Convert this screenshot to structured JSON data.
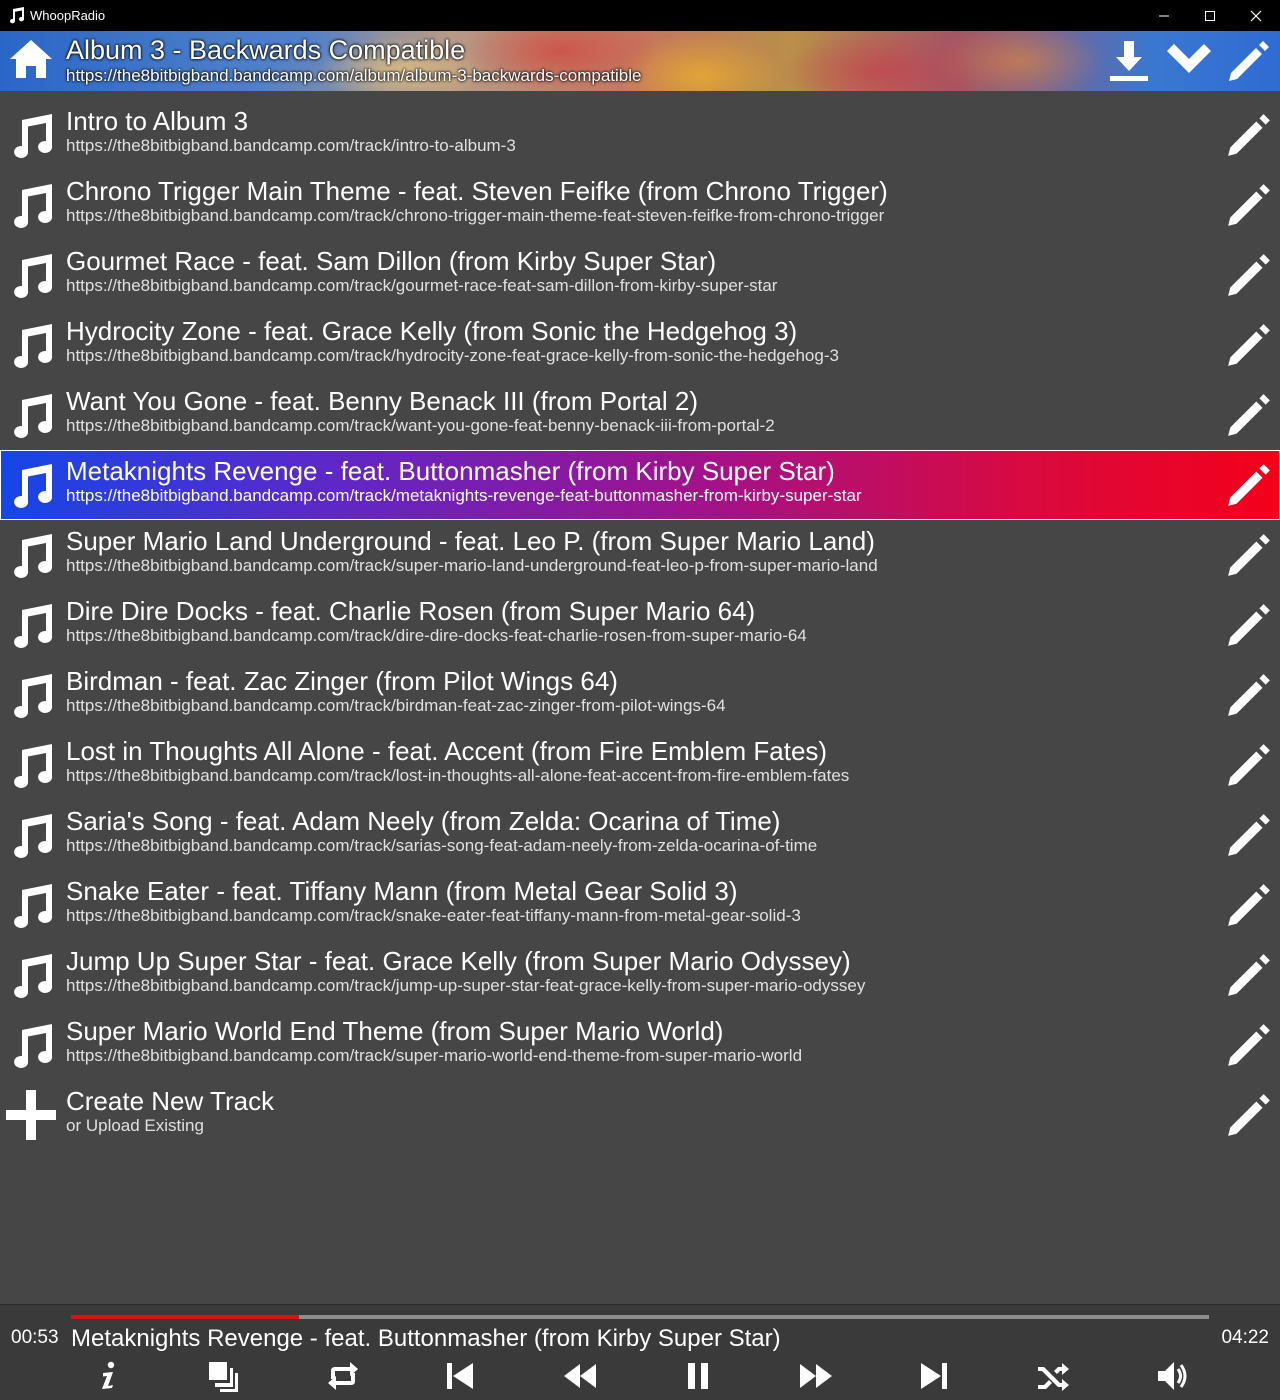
{
  "window": {
    "title": "WhoopRadio",
    "buttons": [
      "minimize",
      "maximize",
      "close"
    ]
  },
  "album": {
    "title": "Album 3 - Backwards Compatible",
    "url": "https://the8bitbigband.bandcamp.com/album/album-3-backwards-compatible",
    "actions": [
      "download-icon",
      "chevron-down-icon",
      "edit-icon"
    ]
  },
  "tracks": [
    {
      "title": "Intro to Album 3",
      "url": "https://the8bitbigband.bandcamp.com/track/intro-to-album-3"
    },
    {
      "title": "Chrono Trigger Main Theme - feat. Steven Feifke (from Chrono Trigger)",
      "url": "https://the8bitbigband.bandcamp.com/track/chrono-trigger-main-theme-feat-steven-feifke-from-chrono-trigger"
    },
    {
      "title": "Gourmet Race - feat. Sam Dillon (from Kirby Super Star)",
      "url": "https://the8bitbigband.bandcamp.com/track/gourmet-race-feat-sam-dillon-from-kirby-super-star"
    },
    {
      "title": "Hydrocity Zone - feat. Grace Kelly (from Sonic the Hedgehog 3)",
      "url": "https://the8bitbigband.bandcamp.com/track/hydrocity-zone-feat-grace-kelly-from-sonic-the-hedgehog-3"
    },
    {
      "title": "Want You Gone - feat. Benny Benack III (from Portal 2)",
      "url": "https://the8bitbigband.bandcamp.com/track/want-you-gone-feat-benny-benack-iii-from-portal-2"
    },
    {
      "title": "Metaknights Revenge - feat. Buttonmasher (from Kirby Super Star)",
      "url": "https://the8bitbigband.bandcamp.com/track/metaknights-revenge-feat-buttonmasher-from-kirby-super-star",
      "active": true
    },
    {
      "title": "Super Mario Land Underground - feat. Leo P. (from Super Mario Land)",
      "url": "https://the8bitbigband.bandcamp.com/track/super-mario-land-underground-feat-leo-p-from-super-mario-land"
    },
    {
      "title": "Dire Dire Docks - feat. Charlie Rosen (from Super Mario 64)",
      "url": "https://the8bitbigband.bandcamp.com/track/dire-dire-docks-feat-charlie-rosen-from-super-mario-64"
    },
    {
      "title": "Birdman - feat. Zac Zinger (from Pilot Wings 64)",
      "url": "https://the8bitbigband.bandcamp.com/track/birdman-feat-zac-zinger-from-pilot-wings-64"
    },
    {
      "title": "Lost in Thoughts All Alone - feat. Accent (from Fire Emblem Fates)",
      "url": "https://the8bitbigband.bandcamp.com/track/lost-in-thoughts-all-alone-feat-accent-from-fire-emblem-fates"
    },
    {
      "title": "Saria's Song - feat. Adam Neely (from Zelda: Ocarina of Time)",
      "url": "https://the8bitbigband.bandcamp.com/track/sarias-song-feat-adam-neely-from-zelda-ocarina-of-time"
    },
    {
      "title": "Snake Eater - feat. Tiffany Mann (from Metal Gear Solid 3)",
      "url": "https://the8bitbigband.bandcamp.com/track/snake-eater-feat-tiffany-mann-from-metal-gear-solid-3"
    },
    {
      "title": "Jump Up Super Star - feat. Grace Kelly (from Super Mario Odyssey)",
      "url": "https://the8bitbigband.bandcamp.com/track/jump-up-super-star-feat-grace-kelly-from-super-mario-odyssey"
    },
    {
      "title": "Super Mario World End Theme (from Super Mario World)",
      "url": "https://the8bitbigband.bandcamp.com/track/super-mario-world-end-theme-from-super-mario-world"
    }
  ],
  "create": {
    "title": "Create New Track",
    "subtitle": "or Upload Existing"
  },
  "player": {
    "current_time": "00:53",
    "total_time": "04:22",
    "now_playing": "Metaknights Revenge - feat. Buttonmasher (from Kirby Super Star)",
    "progress_fraction": 0.2,
    "controls": [
      "info-icon",
      "copy-icon",
      "repeat-icon",
      "skip-previous-icon",
      "rewind-icon",
      "pause-icon",
      "fast-forward-icon",
      "skip-next-icon",
      "shuffle-icon",
      "volume-icon"
    ]
  },
  "colors": {
    "background": "#464646",
    "titlebar": "#000000",
    "active_gradient_start": "#1646e6",
    "active_gradient_end": "#f4001a",
    "progress_fill": "#e01010",
    "progress_track": "#8e8e8e"
  }
}
